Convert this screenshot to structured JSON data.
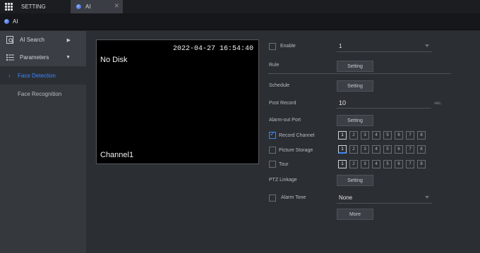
{
  "tabs": [
    {
      "label": "SETTING"
    },
    {
      "label": "AI"
    }
  ],
  "title": "AI",
  "sidebar": {
    "items": [
      {
        "label": "AI Search"
      },
      {
        "label": "Parameters"
      }
    ],
    "sub_items": [
      {
        "label": "Face Detection",
        "active": true
      },
      {
        "label": "Face Recognition",
        "active": false
      }
    ]
  },
  "video": {
    "status": "No Disk",
    "timestamp": "2022-04-27 16:54:40",
    "channel": "Channel1"
  },
  "form": {
    "enable": {
      "label": "Enable",
      "checked": false,
      "value": "1"
    },
    "rule": {
      "label": "Rule",
      "button": "Setting"
    },
    "schedule": {
      "label": "Schedule",
      "button": "Setting"
    },
    "post_record": {
      "label": "Post Record",
      "value": "10",
      "unit": "sec."
    },
    "alarm_out_port": {
      "label": "Alarm-out Port",
      "button": "Setting"
    },
    "record_channel": {
      "label": "Record Channel",
      "checked": true
    },
    "picture_storage": {
      "label": "Picture Storage",
      "checked": false
    },
    "tour": {
      "label": "Tour",
      "checked": false
    },
    "ptz_linkage": {
      "label": "PTZ Linkage",
      "button": "Setting"
    },
    "alarm_tone": {
      "label": "Alarm Tone",
      "checked": false,
      "value": "None"
    },
    "more_button": "More"
  },
  "channels": [
    "1",
    "2",
    "3",
    "4",
    "5",
    "6",
    "7",
    "8"
  ],
  "colors": {
    "accent": "#3a86ff",
    "background": "#2b2e33",
    "sidebar": "#35383d"
  }
}
